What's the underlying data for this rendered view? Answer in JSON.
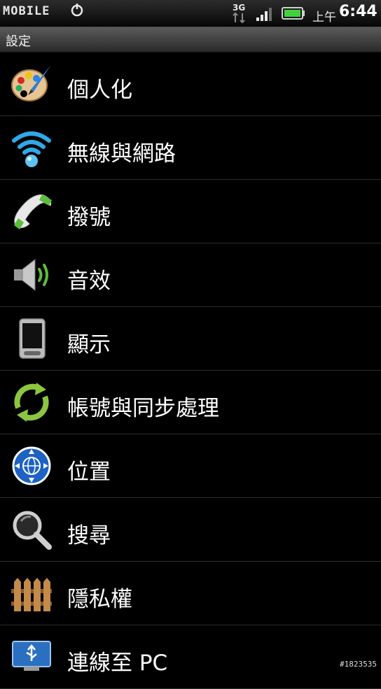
{
  "status": {
    "carrier_logo": "MOBILE",
    "network": "3G",
    "ampm": "上午",
    "time": "6:44"
  },
  "titlebar": {
    "title": "設定"
  },
  "items": [
    {
      "label": "個人化",
      "icon": "palette-icon"
    },
    {
      "label": "無線與網路",
      "icon": "wifi-icon"
    },
    {
      "label": "撥號",
      "icon": "phone-icon"
    },
    {
      "label": "音效",
      "icon": "speaker-icon"
    },
    {
      "label": "顯示",
      "icon": "phone-display-icon"
    },
    {
      "label": "帳號與同步處理",
      "icon": "sync-icon"
    },
    {
      "label": "位置",
      "icon": "globe-icon"
    },
    {
      "label": "搜尋",
      "icon": "magnifier-icon"
    },
    {
      "label": "隱私權",
      "icon": "fence-icon"
    },
    {
      "label": "連線至 PC",
      "icon": "usb-icon"
    }
  ],
  "watermark": "#1823535"
}
